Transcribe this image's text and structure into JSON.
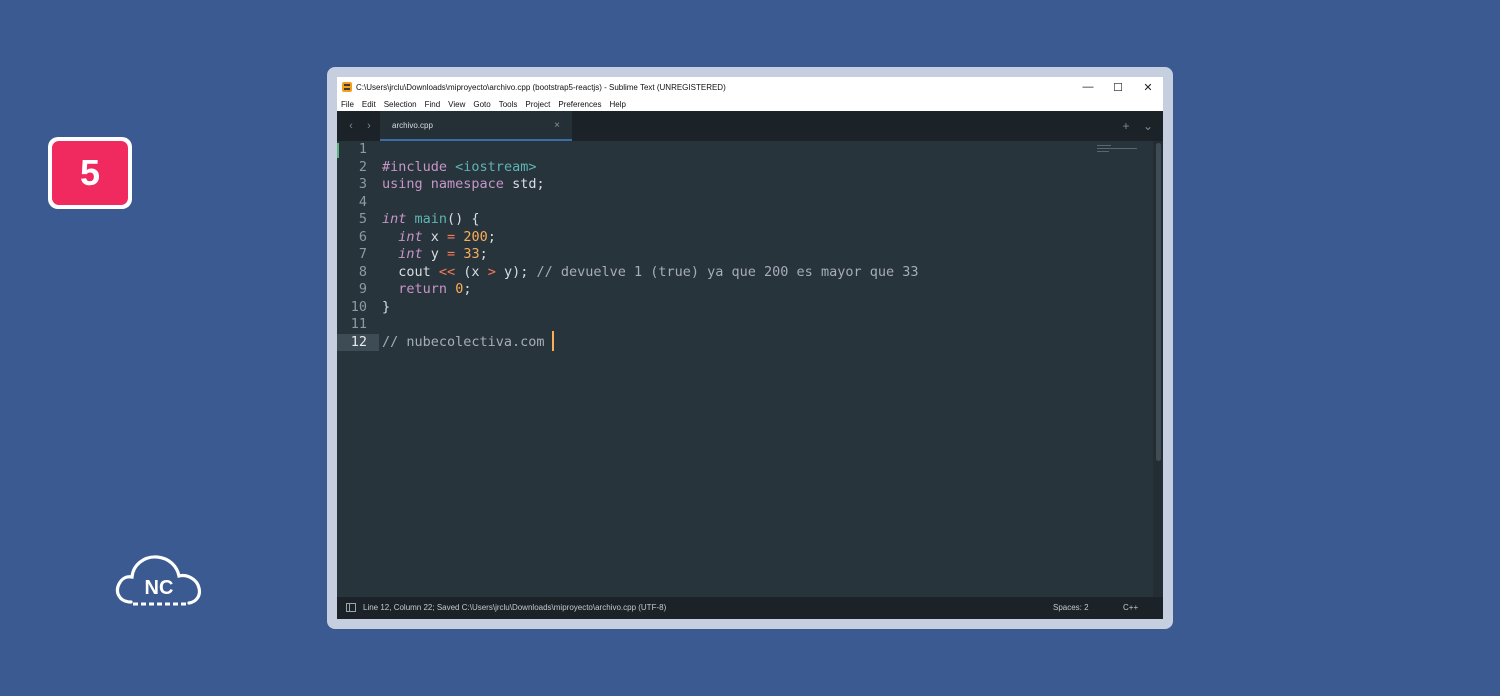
{
  "badge": {
    "number": "5"
  },
  "logo": {
    "text": "NC"
  },
  "window": {
    "title": "C:\\Users\\jrclu\\Downloads\\miproyecto\\archivo.cpp (bootstrap5-reactjs) - Sublime Text (UNREGISTERED)",
    "controls": {
      "minimize": "—",
      "maximize": "☐",
      "close": "✕"
    }
  },
  "menu": {
    "items": [
      "File",
      "Edit",
      "Selection",
      "Find",
      "View",
      "Goto",
      "Tools",
      "Project",
      "Preferences",
      "Help"
    ]
  },
  "tabs": {
    "nav_back": "‹",
    "nav_forward": "›",
    "active_tab": {
      "label": "archivo.cpp",
      "close": "×"
    },
    "add": "+",
    "dropdown": "⌄"
  },
  "editor": {
    "current_line": 12,
    "line_numbers": [
      "1",
      "2",
      "3",
      "4",
      "5",
      "6",
      "7",
      "8",
      "9",
      "10",
      "11",
      "12"
    ],
    "code": {
      "l2_directive": "#include",
      "l2_header": "<iostream>",
      "l3_using": "using",
      "l3_namespace": "namespace",
      "l3_rest": " std;",
      "l5_type": "int",
      "l5_fn": "main",
      "l5_rest": "() {",
      "l6_type": "int",
      "l6_mid": " x ",
      "l6_op": "=",
      "l6_num": "200",
      "l6_end": ";",
      "l7_type": "int",
      "l7_mid": " y ",
      "l7_op": "=",
      "l7_num": "33",
      "l7_end": ";",
      "l8_cout": "cout ",
      "l8_op1": "<<",
      "l8_mid1": " (x ",
      "l8_op2": ">",
      "l8_mid2": " y); ",
      "l8_comment": "// devuelve 1 (true) ya que 200 es mayor que 33",
      "l9_kw": "return",
      "l9_num": "0",
      "l9_end": ";",
      "l10": "}",
      "l12_comment": "// nubecolectiva.com"
    }
  },
  "status": {
    "message": "Line 12, Column 22; Saved C:\\Users\\jrclu\\Downloads\\miproyecto\\archivo.cpp (UTF-8)",
    "spaces": "Spaces: 2",
    "syntax": "C++"
  },
  "colors": {
    "background": "#3b5a91",
    "badge": "#f0295f",
    "editor_bg": "#28343c",
    "keyword": "#c795c7",
    "function": "#5fb3b3",
    "number": "#f9ae58",
    "operator": "#f97b58",
    "comment": "#a6acb9"
  }
}
